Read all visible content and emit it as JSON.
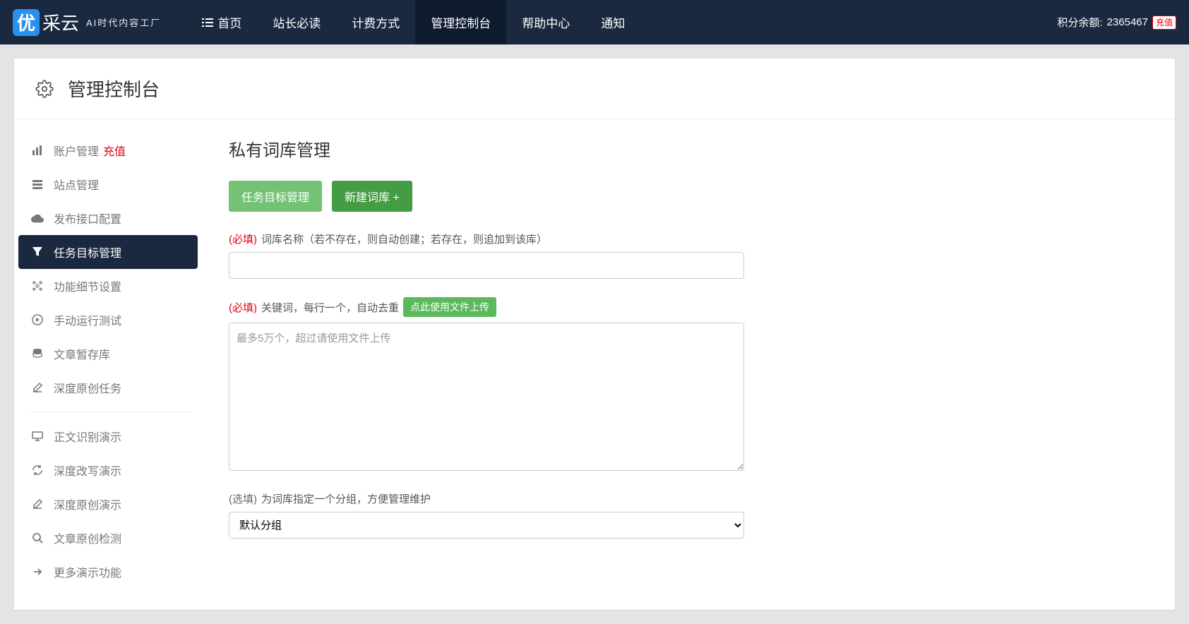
{
  "brand": {
    "badge": "优",
    "name": "采云",
    "sub": "AI时代内容工厂"
  },
  "nav": {
    "items": [
      {
        "label": "首页"
      },
      {
        "label": "站长必读"
      },
      {
        "label": "计费方式"
      },
      {
        "label": "管理控制台"
      },
      {
        "label": "帮助中心"
      },
      {
        "label": "通知"
      }
    ],
    "active_index": 3
  },
  "balance": {
    "label": "积分余额:",
    "value": "2365467",
    "recharge": "充值"
  },
  "panel": {
    "title": "管理控制台"
  },
  "sidebar": {
    "group1": [
      {
        "icon": "bar-chart-icon",
        "label": "账户管理",
        "badge": "充值"
      },
      {
        "icon": "layers-icon",
        "label": "站点管理"
      },
      {
        "icon": "cloud-upload-icon",
        "label": "发布接口配置"
      },
      {
        "icon": "filter-icon",
        "label": "任务目标管理",
        "active": true
      },
      {
        "icon": "sliders-icon",
        "label": "功能细节设置"
      },
      {
        "icon": "play-circle-icon",
        "label": "手动运行测试"
      },
      {
        "icon": "database-icon",
        "label": "文章暂存库"
      },
      {
        "icon": "edit-icon",
        "label": "深度原创任务"
      }
    ],
    "group2": [
      {
        "icon": "monitor-icon",
        "label": "正文识别演示"
      },
      {
        "icon": "refresh-icon",
        "label": "深度改写演示"
      },
      {
        "icon": "edit-icon",
        "label": "深度原创演示"
      },
      {
        "icon": "search-icon",
        "label": "文章原创检测"
      },
      {
        "icon": "share-icon",
        "label": "更多演示功能"
      }
    ]
  },
  "main": {
    "title": "私有词库管理",
    "buttons": {
      "manage": "任务目标管理",
      "create": "新建词库 +"
    },
    "field1": {
      "req": "(必填)",
      "label": "词库名称（若不存在，则自动创建；若存在，则追加到该库）"
    },
    "field2": {
      "req": "(必填)",
      "label": "关键词，每行一个，自动去重",
      "upload": "点此使用文件上传",
      "placeholder": "最多5万个，超过请使用文件上传"
    },
    "field3": {
      "opt": "(选填)",
      "label": "为词库指定一个分组，方便管理维护",
      "option": "默认分组"
    }
  }
}
